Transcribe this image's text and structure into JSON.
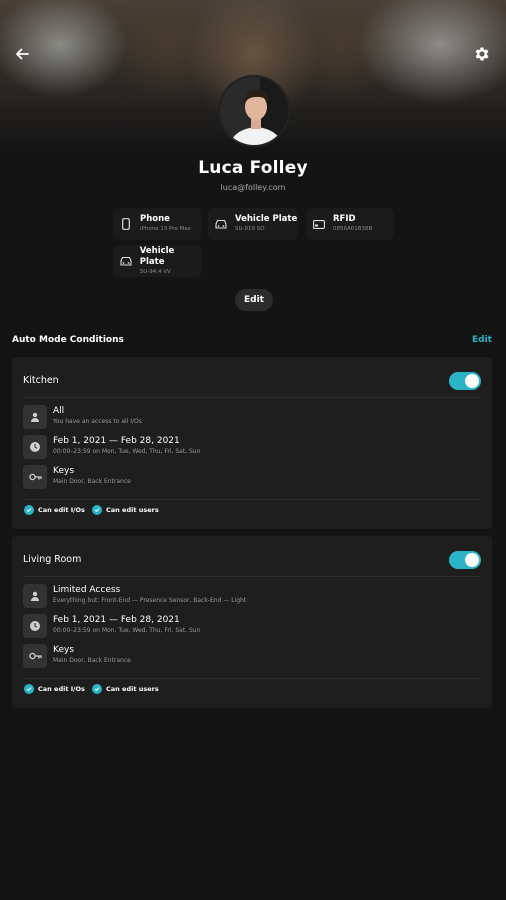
{
  "profile": {
    "name": "Luca Folley",
    "email": "luca@folley.com"
  },
  "credentials": [
    {
      "icon": "phone-icon",
      "title": "Phone",
      "subtitle": "iPhone 13 Pro Max"
    },
    {
      "icon": "car-icon",
      "title": "Vehicle Plate",
      "subtitle": "SU-919 SO"
    },
    {
      "icon": "rfid-card-icon",
      "title": "RFID",
      "subtitle": "0856A01B38B"
    },
    {
      "icon": "car-icon",
      "title": "Vehicle Plate",
      "subtitle": "SU-94.4 VV"
    }
  ],
  "profile_edit_label": "Edit",
  "auto_mode": {
    "title": "Auto Mode Conditions",
    "edit_label": "Edit"
  },
  "rooms": [
    {
      "name": "Kitchen",
      "enabled": true,
      "rows": [
        {
          "icon": "user-access-icon",
          "title": "All",
          "subtitle": "You have an access to all I/Os"
        },
        {
          "icon": "clock-icon",
          "title": "Feb 1, 2021 — Feb 28, 2021",
          "subtitle": "00:00–23:59 on Mon, Tue, Wed, Thu, Fri, Sat, Sun"
        },
        {
          "icon": "key-icon",
          "title": "Keys",
          "subtitle": "Main Door, Back Entrance"
        }
      ],
      "permissions": [
        "Can edit I/Os",
        "Can edit users"
      ]
    },
    {
      "name": "Living Room",
      "enabled": true,
      "rows": [
        {
          "icon": "user-access-icon",
          "title": "Limited Access",
          "subtitle": "Everything but: Front-End — Presence Sensor, Back-End — Light"
        },
        {
          "icon": "clock-icon",
          "title": "Feb 1, 2021 — Feb 28, 2021",
          "subtitle": "00:00–23:59 on Mon, Tue, Wed, Thu, Fri, Sat, Sun"
        },
        {
          "icon": "key-icon",
          "title": "Keys",
          "subtitle": "Main Door, Back Entrance"
        }
      ],
      "permissions": [
        "Can edit I/Os",
        "Can edit users"
      ]
    }
  ],
  "colors": {
    "accent": "#2bb3c7",
    "background": "#141414",
    "card": "#1e1e1e"
  }
}
